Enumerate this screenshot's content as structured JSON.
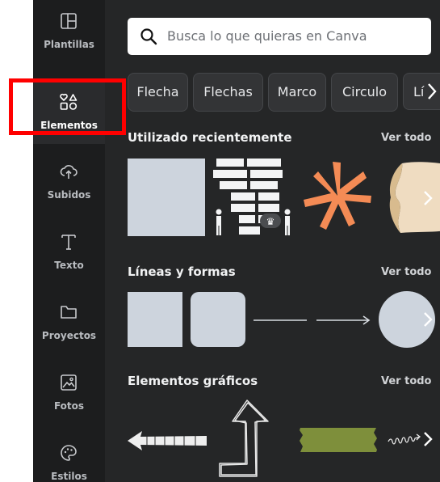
{
  "colors": {
    "panel_bg": "#252627",
    "rail_bg": "#1c1d1e",
    "highlight": "#ff0000",
    "shape_fill": "#cdd4dd"
  },
  "sidebar": {
    "items": [
      {
        "label": "Plantillas",
        "icon": "template-icon",
        "active": false
      },
      {
        "label": "Elementos",
        "icon": "shapes-icon",
        "active": true
      },
      {
        "label": "Subidos",
        "icon": "cloud-upload-icon",
        "active": false
      },
      {
        "label": "Texto",
        "icon": "text-icon",
        "active": false
      },
      {
        "label": "Proyectos",
        "icon": "folder-icon",
        "active": false
      },
      {
        "label": "Fotos",
        "icon": "image-icon",
        "active": false
      },
      {
        "label": "Estilos",
        "icon": "palette-icon",
        "active": false
      }
    ]
  },
  "search": {
    "placeholder": "Busca lo que quieras en Canva",
    "icon": "search-icon"
  },
  "chips": [
    "Flecha",
    "Flechas",
    "Marco",
    "Circulo",
    "Lí"
  ],
  "sections": [
    {
      "title": "Utilizado recientemente",
      "see_all": "Ver todo"
    },
    {
      "title": "Líneas y formas",
      "see_all": "Ver todo"
    },
    {
      "title": "Elementos gráficos",
      "see_all": "Ver todo"
    }
  ]
}
